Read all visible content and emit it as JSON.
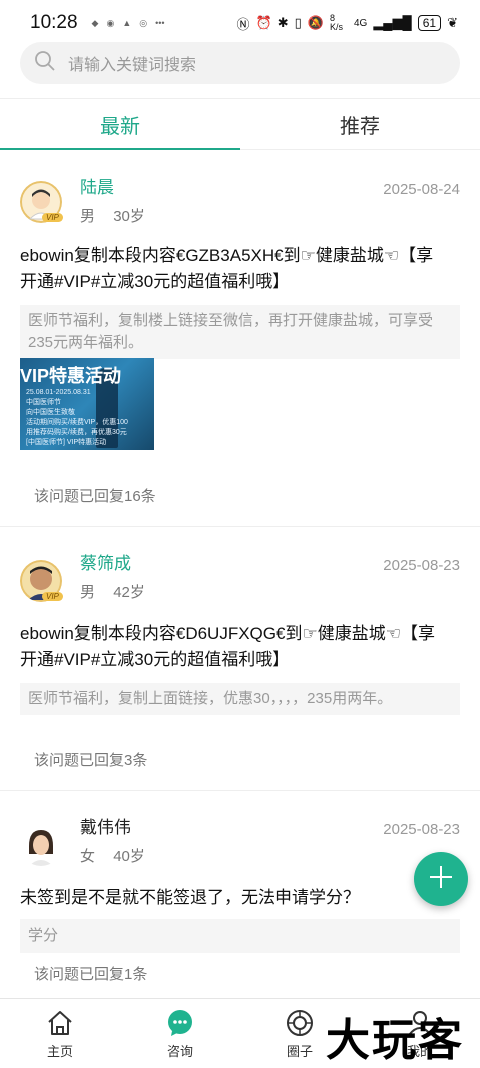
{
  "status_bar": {
    "time": "10:28",
    "network_speed": "8 K/s",
    "signal_label": "4G",
    "battery": "61"
  },
  "search": {
    "placeholder": "请输入关键词搜索"
  },
  "tabs": [
    {
      "label": "最新",
      "active": true
    },
    {
      "label": "推荐",
      "active": false
    }
  ],
  "posts": [
    {
      "user": "陆晨",
      "vip": "VIP",
      "gender": "男",
      "age": "30岁",
      "date": "2025-08-24",
      "title_line1": "ebowin复制本段内容€GZB3A5XH€到☞健康盐城☜【享",
      "title_line2": "开通#VIP#立减30元的超值福利哦】",
      "note": "医师节福利，复制楼上链接至微信，再打开健康盐城，可享受235元两年福利。",
      "image": {
        "title": "VIP特惠活动",
        "lines": [
          "25.08.01-2025.08.31",
          "中国医师节",
          "向中国医生致敬",
          "活动期间购买/续费VIP，优惠100",
          "用推荐码购买/续费，再优惠30元",
          "[中国医师节] VIP特惠活动"
        ]
      },
      "replies": "该问题已回复16条"
    },
    {
      "user": "蔡筛成",
      "vip": "VIP",
      "gender": "男",
      "age": "42岁",
      "date": "2025-08-23",
      "title_line1": "ebowin复制本段内容€D6UJFXQG€到☞健康盐城☜【享",
      "title_line2": "开通#VIP#立减30元的超值福利哦】",
      "note": "医师节福利，复制上面链接，优惠30，，，，235用两年。",
      "replies": "该问题已回复3条"
    },
    {
      "user": "戴伟伟",
      "gender": "女",
      "age": "40岁",
      "date": "2025-08-23",
      "title_line1": "未签到是不是就不能签退了，无法申请学分？",
      "note": "学分",
      "replies": "该问题已回复1条"
    }
  ],
  "bottom_nav": [
    {
      "label": "主页",
      "icon": "home-icon"
    },
    {
      "label": "咨询",
      "icon": "chat-icon",
      "active": true
    },
    {
      "label": "圈子",
      "icon": "circle-icon"
    },
    {
      "label": "我的",
      "icon": "profile-icon"
    }
  ],
  "watermark": "大玩客",
  "colors": {
    "accent": "#1fa88a",
    "fab": "#1fb38f"
  }
}
